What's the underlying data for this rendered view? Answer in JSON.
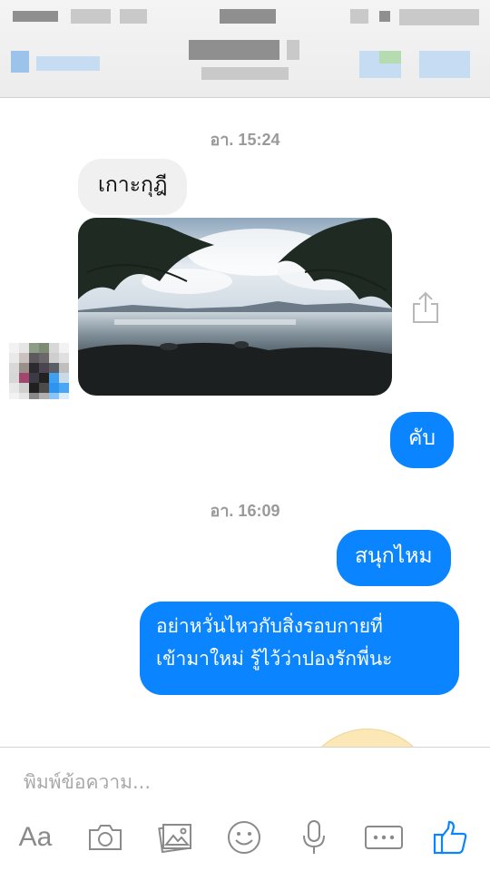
{
  "thread": {
    "timestamp_1": "อา. 15:24",
    "timestamp_2": "อา. 16:09",
    "messages": [
      {
        "from": "them",
        "text": "เกาะกุฎี"
      },
      {
        "from": "them",
        "type": "photo"
      },
      {
        "from": "me",
        "text": "คับ"
      },
      {
        "from": "me",
        "text": "สนุกไหม"
      },
      {
        "from": "me",
        "line1": "อย่าหวั่นไหวกับสิ่งรอบกายที่",
        "line2": "เข้ามาใหม่ รู้ไว้ว่าปองรักพี่นะ"
      }
    ]
  },
  "composer": {
    "placeholder": "พิมพ์ข้อความ...",
    "aa_label": "Aa"
  },
  "icons": {
    "share": "share-icon",
    "camera": "camera-icon",
    "gallery": "gallery-icon",
    "emoji": "emoji-icon",
    "mic": "microphone-icon",
    "more": "more-icon",
    "like": "thumbs-up-icon"
  },
  "colors": {
    "outgoing_bubble": "#0a84ff",
    "incoming_bubble": "#f0f0f0",
    "accent": "#0a84ff"
  }
}
